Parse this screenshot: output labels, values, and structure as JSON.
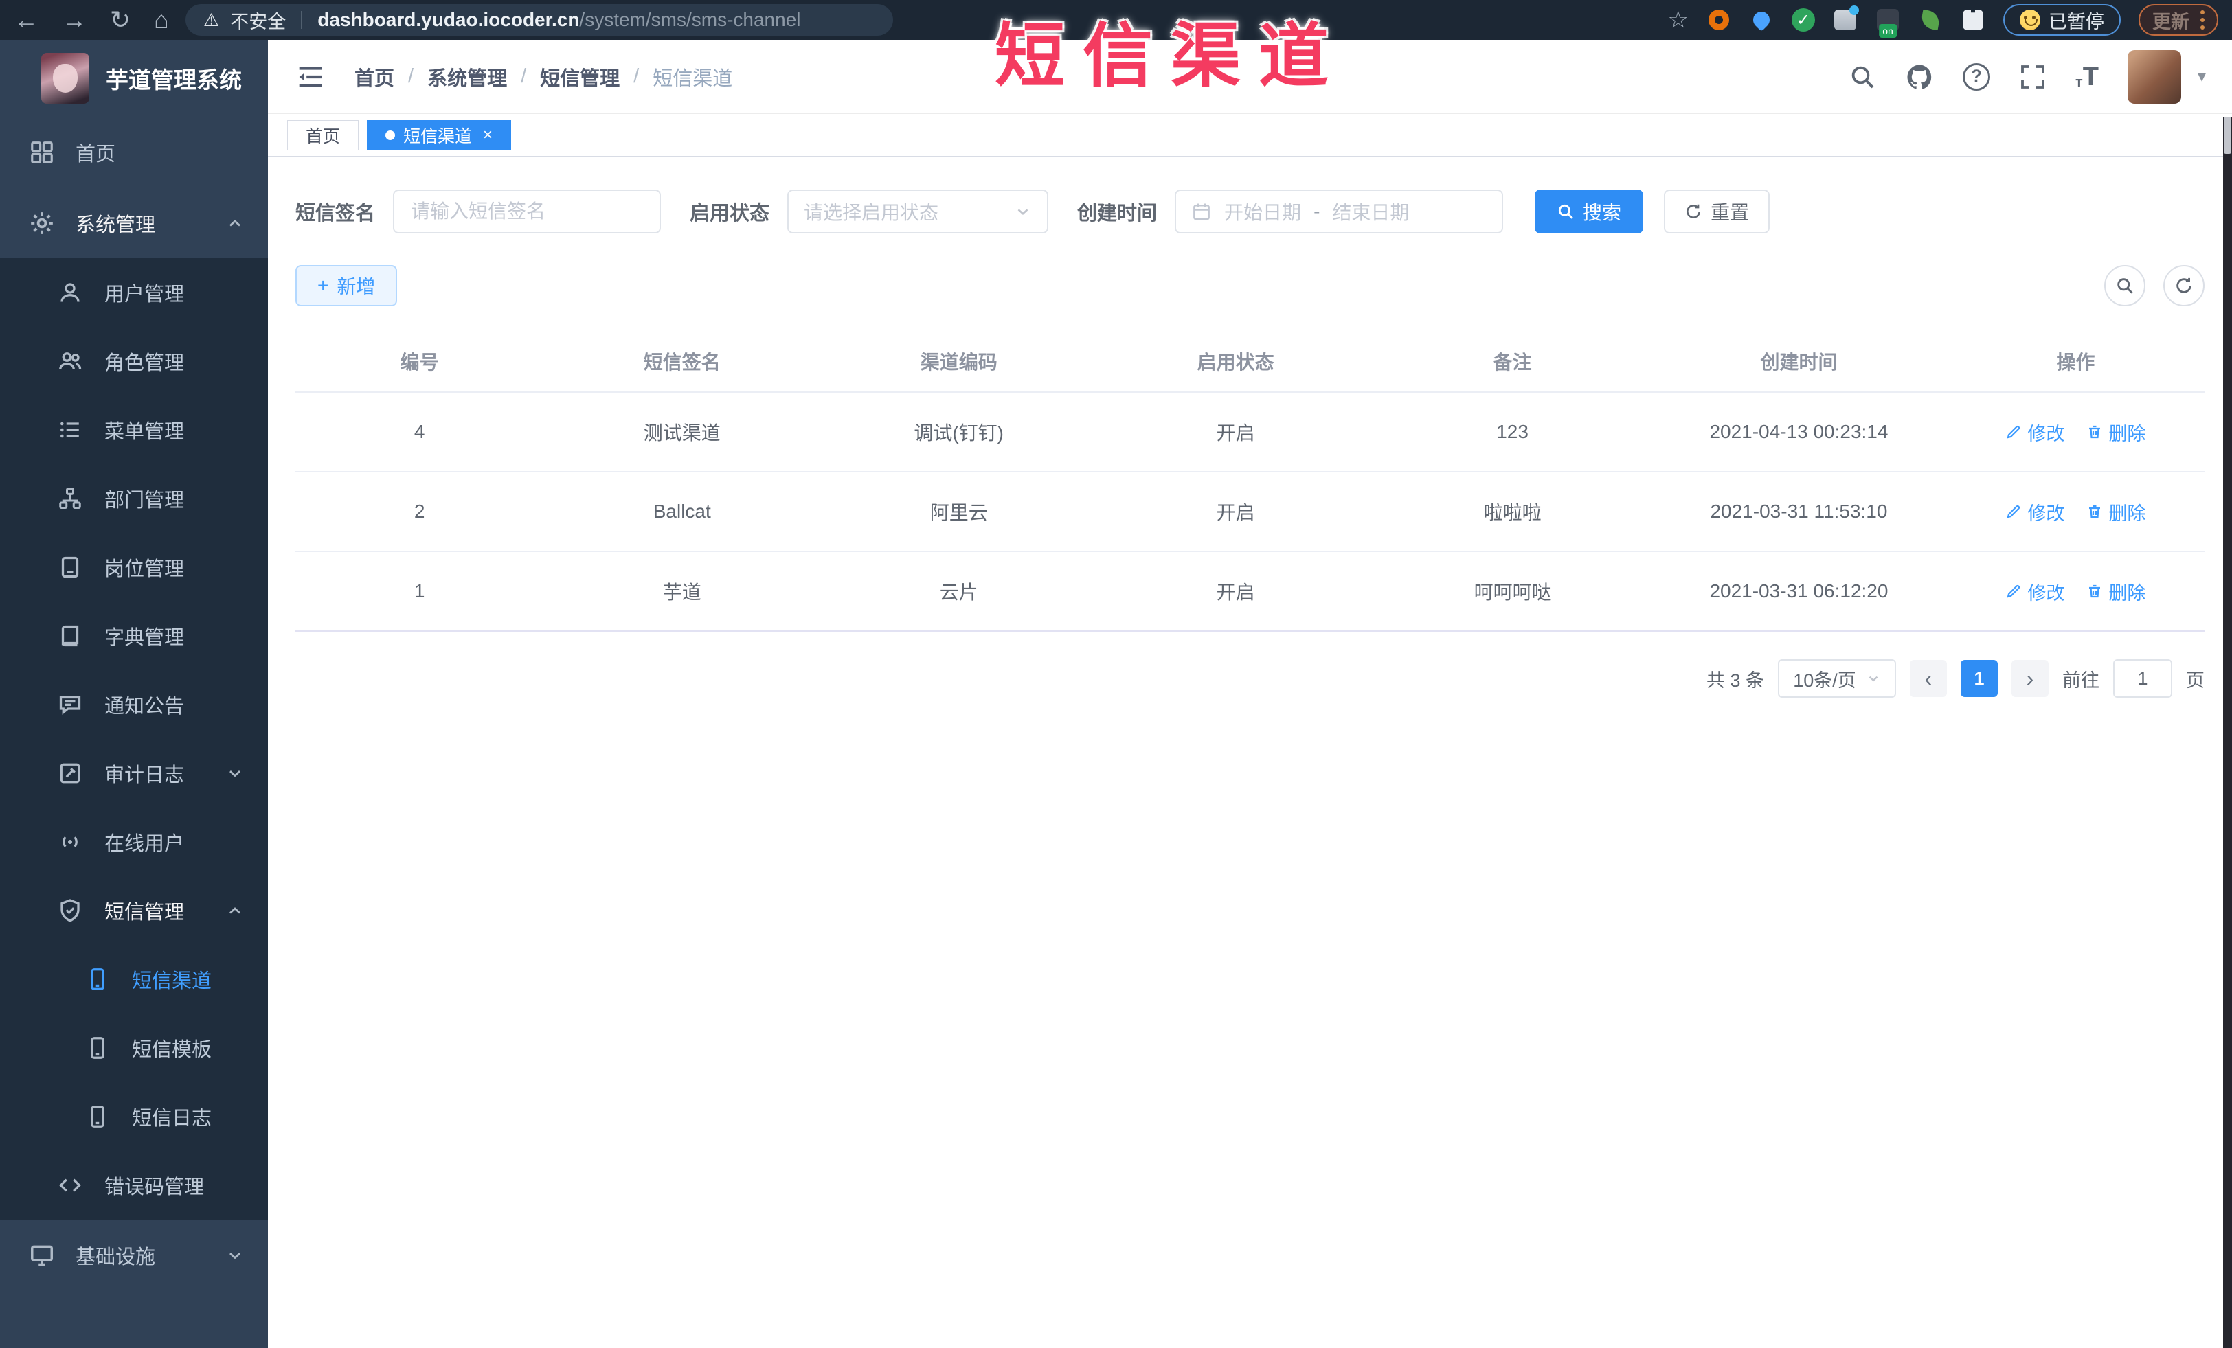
{
  "browser": {
    "security_label": "不安全",
    "url_domain": "dashboard.yudao.iocoder.cn",
    "url_path": "/system/sms/sms-channel",
    "extension_badge": "on",
    "paused_badge": "已暂停",
    "update_button": "更新"
  },
  "icons": {
    "back": "←",
    "forward": "→",
    "reload": "↻",
    "home": "⌂",
    "warning": "⚠",
    "star": "☆",
    "caret_down": "▾",
    "plus": "+",
    "close": "×",
    "prev": "‹",
    "next": "›",
    "question": "?",
    "check": "✓"
  },
  "watermark": "短信渠道",
  "sidebar": {
    "title": "芋道管理系统",
    "items": [
      {
        "label": "首页"
      },
      {
        "label": "系统管理"
      },
      {
        "label": "用户管理"
      },
      {
        "label": "角色管理"
      },
      {
        "label": "菜单管理"
      },
      {
        "label": "部门管理"
      },
      {
        "label": "岗位管理"
      },
      {
        "label": "字典管理"
      },
      {
        "label": "通知公告"
      },
      {
        "label": "审计日志"
      },
      {
        "label": "在线用户"
      },
      {
        "label": "短信管理"
      },
      {
        "label": "短信渠道"
      },
      {
        "label": "短信模板"
      },
      {
        "label": "短信日志"
      },
      {
        "label": "错误码管理"
      },
      {
        "label": "基础设施"
      }
    ]
  },
  "header": {
    "breadcrumb": [
      "首页",
      "系统管理",
      "短信管理",
      "短信渠道"
    ]
  },
  "tabs": [
    {
      "label": "首页"
    },
    {
      "label": "短信渠道"
    }
  ],
  "filters": {
    "sign_label": "短信签名",
    "sign_placeholder": "请输入短信签名",
    "status_label": "启用状态",
    "status_placeholder": "请选择启用状态",
    "time_label": "创建时间",
    "start_placeholder": "开始日期",
    "range_separator": "-",
    "end_placeholder": "结束日期",
    "search_label": "搜索",
    "reset_label": "重置"
  },
  "toolbar": {
    "add_label": "新增"
  },
  "table": {
    "headers": [
      "编号",
      "短信签名",
      "渠道编码",
      "启用状态",
      "备注",
      "创建时间",
      "操作"
    ],
    "rows": [
      {
        "id": "4",
        "sign": "测试渠道",
        "code": "调试(钉钉)",
        "status": "开启",
        "remark": "123",
        "created": "2021-04-13 00:23:14"
      },
      {
        "id": "2",
        "sign": "Ballcat",
        "code": "阿里云",
        "status": "开启",
        "remark": "啦啦啦",
        "created": "2021-03-31 11:53:10"
      },
      {
        "id": "1",
        "sign": "芋道",
        "code": "云片",
        "status": "开启",
        "remark": "呵呵呵哒",
        "created": "2021-03-31 06:12:20"
      }
    ],
    "edit_label": "修改",
    "delete_label": "删除"
  },
  "pagination": {
    "total": "共 3 条",
    "page_size": "10条/页",
    "current_page": "1",
    "goto_label": "前往",
    "goto_value": "1",
    "page_suffix": "页"
  },
  "colors": {
    "accent_blue": "#2f8df4",
    "link_blue": "#409eff",
    "sidebar_bg": "#304156",
    "sidebar_sub_bg": "#1f2d3d",
    "watermark_red": "#f43b60"
  }
}
